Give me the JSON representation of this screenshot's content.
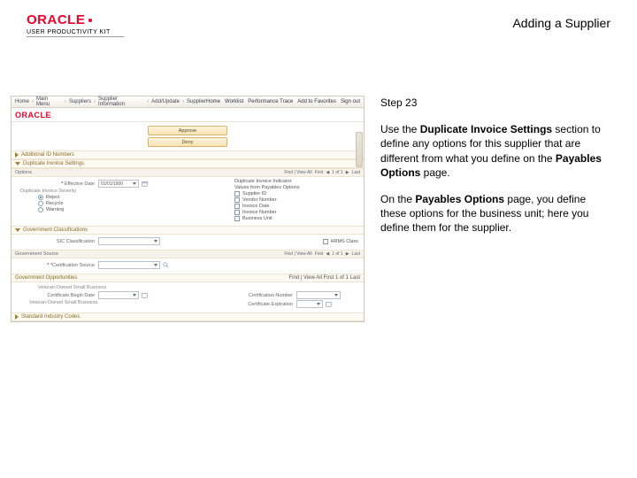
{
  "header": {
    "brand": "ORACLE",
    "upk": "USER PRODUCTIVITY KIT",
    "title": "Adding a Supplier"
  },
  "instruction": {
    "step": "Step 23",
    "p1a": "Use the ",
    "p1b": "Duplicate Invoice Settings",
    "p1c": " section to define any options for this supplier that are different from what you define on the ",
    "p1d": "Payables Options",
    "p1e": " page.",
    "p2a": "On the ",
    "p2b": "Payables Options",
    "p2c": " page, you define these options for the business unit; here you define them for the supplier."
  },
  "app": {
    "crumbs": [
      "Home",
      "Main Menu",
      "Suppliers",
      "Supplier Information",
      "Add/Update",
      "Supplier"
    ],
    "topmenu": [
      "Home",
      "Worklist",
      "Performance Trace",
      "Add to Favorites",
      "Sign out"
    ],
    "brand": "ORACLE",
    "buttons": {
      "approve": "Approve",
      "deny": "Deny"
    },
    "sections": {
      "addtl": "Additional ID Numbers",
      "dup": "Duplicate Invoice Settings",
      "gov": "Government Classifications",
      "std": "Standard Industry Codes"
    },
    "options_label": "Options",
    "effdate": {
      "label": "Effective Date",
      "value": "01/01/1900"
    },
    "dup_settings": {
      "title": "Duplicate Invoice Indicator",
      "values_from": "Values from Payables Options",
      "opts": [
        "Supplier ID",
        "Vendor Number",
        "Invoice Date",
        "Invoice Number",
        "Business Unit"
      ]
    },
    "severity": {
      "label": "Duplicate Invoice Severity",
      "opts": [
        "Reject",
        "Recycle",
        "Warning"
      ]
    },
    "govsrc": {
      "label": "Government Source",
      "hint": "Find | View All"
    },
    "cert": {
      "source_label": "*Certification Source",
      "begin_label": "Certificate Begin Date",
      "num_label": "Certification Number",
      "exp_label": "Certificate Expiration"
    },
    "sic_label": "SIC Classification",
    "hrms_label": "HRMS Class",
    "gov_oppo": "Government Opportunities",
    "veteran": "Veteran-Owned Small Business",
    "tabpager": {
      "first": "First",
      "prev": "◀",
      "info": "1 of 1",
      "next": "▶",
      "last": "Last"
    },
    "view": "View All"
  }
}
